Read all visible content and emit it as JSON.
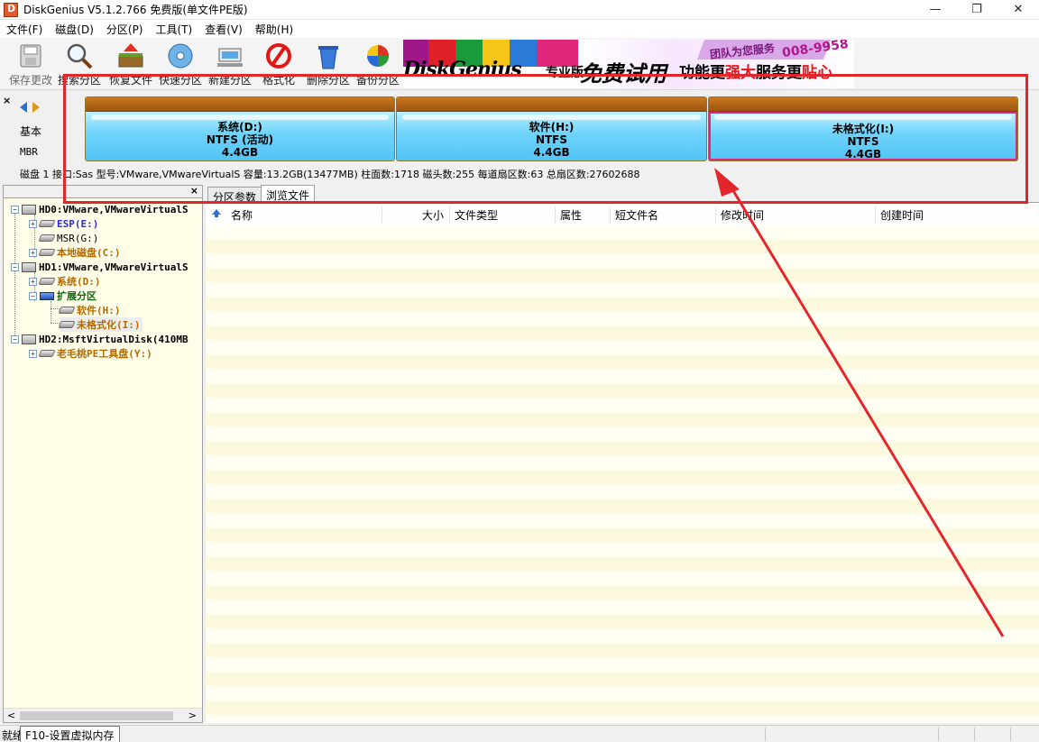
{
  "window": {
    "title": "DiskGenius V5.1.2.766 免费版(单文件PE版)",
    "min": "—",
    "max": "❐",
    "close": "✕"
  },
  "menu": [
    "文件(F)",
    "磁盘(D)",
    "分区(P)",
    "工具(T)",
    "查看(V)",
    "帮助(H)"
  ],
  "toolbar": {
    "save": "保存更改",
    "search": "搜索分区",
    "recover": "恢复文件",
    "quick": "快速分区",
    "new": "新建分区",
    "format": "格式化",
    "delete": "删除分区",
    "backup": "备份分区"
  },
  "banner": {
    "logo": "DiskGenius",
    "edition": "专业版",
    "free_trial": "免费试用",
    "slogan_a": "功能更",
    "slogan_b": "强大",
    "slogan_c": "服务更",
    "slogan_d": "贴心",
    "service": "团队为您服务",
    "phone": "008-9958"
  },
  "diskmap": {
    "disk_type": "基本",
    "partition_style": "MBR",
    "partitions": [
      {
        "name": "系统(D:)",
        "fs": "NTFS (活动)",
        "size": "4.4GB"
      },
      {
        "name": "软件(H:)",
        "fs": "NTFS",
        "size": "4.4GB"
      },
      {
        "name": "未格式化(I:)",
        "fs": "NTFS",
        "size": "4.4GB"
      }
    ],
    "info": "磁盘 1 接口:Sas  型号:VMware,VMwareVirtualS  容量:13.2GB(13477MB)  柱面数:1718  磁头数:255  每道扇区数:63  总扇区数:27602688"
  },
  "tree": {
    "items": [
      {
        "label": "HD0:VMware,VMwareVirtualS"
      },
      {
        "label": "ESP(E:)"
      },
      {
        "label": "MSR(G:)"
      },
      {
        "label": "本地磁盘(C:)"
      },
      {
        "label": "HD1:VMware,VMwareVirtualS"
      },
      {
        "label": "系统(D:)"
      },
      {
        "label": "扩展分区"
      },
      {
        "label": "软件(H:)"
      },
      {
        "label": "未格式化(I:)"
      },
      {
        "label": "HD2:MsftVirtualDisk(410MB"
      },
      {
        "label": "老毛桃PE工具盘(Y:)"
      }
    ]
  },
  "tabs": [
    "分区参数",
    "浏览文件"
  ],
  "columns": [
    "名称",
    "大小",
    "文件类型",
    "属性",
    "短文件名",
    "修改时间",
    "创建时间"
  ],
  "status": {
    "ready": "就绪",
    "tip": "F10-设置虚拟内存"
  },
  "colors": {
    "annotation": "#e3262c",
    "partition_cap": "#b06414",
    "partition_body": "#6ed3fb",
    "selected_border": "#e0287a"
  }
}
